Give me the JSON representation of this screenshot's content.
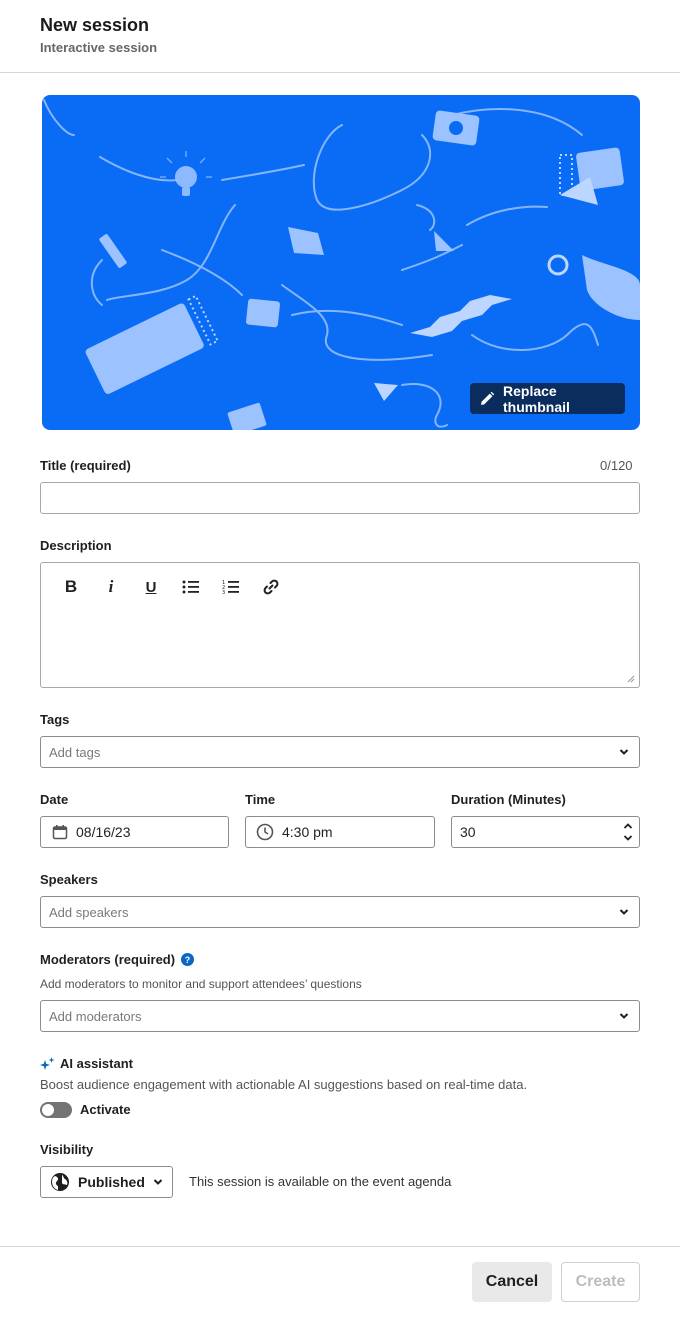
{
  "header": {
    "title": "New session",
    "subtitle": "Interactive session"
  },
  "thumbnail": {
    "replace_label": "Replace thumbnail",
    "background_color": "#0a6cf5"
  },
  "title_field": {
    "label": "Title (required)",
    "counter": "0/120",
    "value": ""
  },
  "description": {
    "label": "Description",
    "toolbar": [
      "bold-icon",
      "italic-icon",
      "underline-icon",
      "bulleted-list-icon",
      "numbered-list-icon",
      "link-icon"
    ]
  },
  "tags": {
    "label": "Tags",
    "placeholder": "Add tags"
  },
  "date": {
    "label": "Date",
    "value": "08/16/23"
  },
  "time": {
    "label": "Time",
    "value": "4:30 pm"
  },
  "duration": {
    "label": "Duration (Minutes)",
    "value": "30"
  },
  "speakers": {
    "label": "Speakers",
    "placeholder": "Add speakers"
  },
  "moderators": {
    "label": "Moderators (required)",
    "hint": "Add moderators to monitor and support attendees’ questions",
    "placeholder": "Add moderators"
  },
  "ai_assistant": {
    "label": "AI assistant",
    "description": "Boost audience engagement with actionable AI suggestions based on real-time data.",
    "toggle_label": "Activate",
    "enabled": false
  },
  "visibility": {
    "label": "Visibility",
    "selected": "Published",
    "description": "This session is available on the event agenda"
  },
  "footer": {
    "cancel_label": "Cancel",
    "create_label": "Create"
  },
  "colors": {
    "accent": "#0a66c2",
    "toggle_off": "#737373",
    "thumbnail_dark": "#0b2d5e"
  }
}
